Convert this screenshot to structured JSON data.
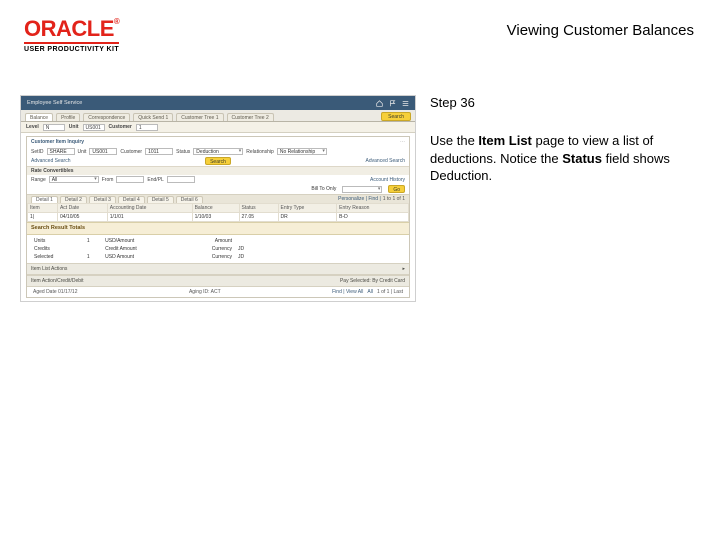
{
  "header": {
    "brand": "ORACLE",
    "subbrand": "USER PRODUCTIVITY KIT",
    "page_title": "Viewing Customer Balances"
  },
  "sidebar": {
    "step_label": "Step 36",
    "instruction_pre": "Use the ",
    "instruction_bold1": "Item List",
    "instruction_mid": " page to view a list of deductions. Notice the ",
    "instruction_bold2": "Status",
    "instruction_post": " field shows Deduction."
  },
  "screenshot": {
    "topbar_title": "Employee Self Service",
    "tabs": [
      "Balance",
      "Profile",
      "Correspondence",
      "Quick Send 1",
      "Customer Tree 1",
      "Customer Tree 2"
    ],
    "search_btn": "Search",
    "level_label": "Level",
    "level_val": "N",
    "unit_label": "Unit",
    "unit_val": "US001",
    "customer_label": "Customer",
    "customer_val": "1",
    "inquiry_title": "Customer Item Inquiry",
    "adv_search": "Advanced Search",
    "setid_label": "SetID",
    "setid_val": "SHARE",
    "unit2_label": "Unit",
    "unit2_val": "US001",
    "customer2_label": "Customer",
    "customer2_val": "1011",
    "status_label": "Status",
    "status_val": "Deduction",
    "rel_label": "Relationship",
    "rel_val": "No Relationship",
    "convertibles": "Rate Convertibles",
    "acct_label": "Account History",
    "range_label": "Range",
    "all_val": "All",
    "from_label": "From",
    "from_val": "",
    "to_label": "End/PL",
    "to_val": "",
    "billto_label": "Bill To Only",
    "result_head": "Search Result Totals",
    "detail_tabs": [
      "Detail 1",
      "Detail 2",
      "Detail 3",
      "Detail 4",
      "Detail 5",
      "Detail 6"
    ],
    "cols": [
      "Item",
      "Act Date",
      "Accounting Date",
      "Balance",
      "Status",
      "Entry Type",
      "Entry Reason"
    ],
    "row": [
      "1|",
      "04/10/05",
      "1/1/01",
      "1/1/01",
      "1/10/03",
      "27.05",
      "DR",
      "B-D",
      "",
      "1 to 1 of 1"
    ],
    "personalize": "Personalize | Find |",
    "totals": [
      [
        "Units",
        "1",
        "USD/Amount",
        "",
        "",
        "Amount"
      ],
      [
        "Credits",
        "",
        "Credit Amount",
        "",
        "",
        "Currency",
        "JD"
      ],
      [
        "Selected",
        "1",
        "USD Amount",
        "",
        "",
        "Currency",
        "JD"
      ]
    ],
    "section1": "Item List Actions",
    "section2_left": "Item Action/Credit/Debit",
    "section2_right": "Pay Selected: By Credit Card",
    "aged_label": "Aged Date  01/17/12",
    "aging_label": "Aging ID: ACT",
    "all_link": "All",
    "pager": "1 of 1 | Last",
    "viewall": "Find | View All"
  }
}
